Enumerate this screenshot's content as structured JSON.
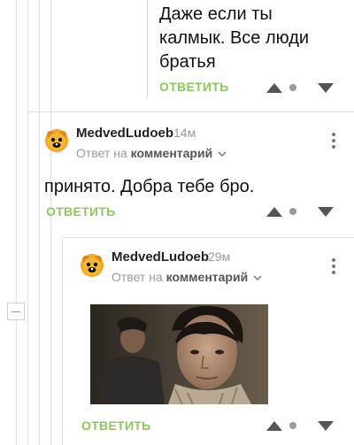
{
  "comment_top": {
    "text_lines": [
      "Даже если ты",
      "калмык. Все люди",
      "братья"
    ],
    "reply_label": "ОТВЕТИТЬ"
  },
  "comment_1": {
    "username": "MedvedLudoeb",
    "time": "14м",
    "reply_to_prefix": "Ответ на",
    "reply_to_target": "комментарий",
    "text": "принято. Добра тебе бро.",
    "reply_label": "ОТВЕТИТЬ"
  },
  "comment_2": {
    "username": "MedvedLudoeb",
    "time": "29м",
    "reply_to_prefix": "Ответ на",
    "reply_to_target": "комментарий",
    "attachment": "gif-image",
    "reply_label": "ОТВЕТИТЬ"
  },
  "icons": {
    "upvote": "triangle-up-icon",
    "rating": "dot-icon",
    "downvote": "triangle-down-icon",
    "menu": "more-vertical-icon",
    "collapse": "minus-icon",
    "dropdown": "chevron-down-icon"
  },
  "colors": {
    "reply_link": "#8ac858",
    "vote_icon": "#555555",
    "muted_text": "#9a9a9a",
    "thread_line": "#e0e0e0"
  }
}
